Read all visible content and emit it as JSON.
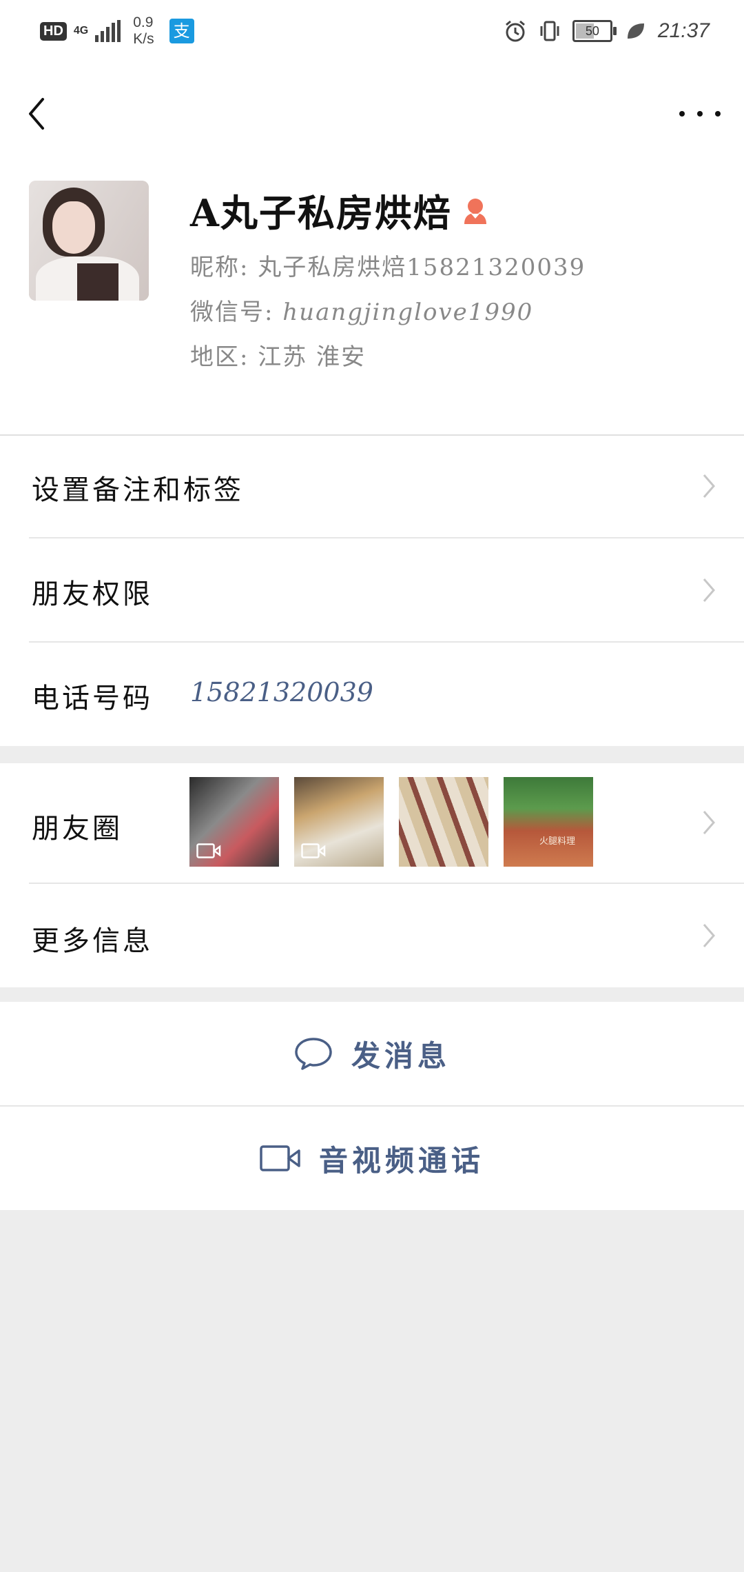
{
  "status_bar": {
    "hd": "HD",
    "network": "4G",
    "speed_value": "0.9",
    "speed_unit": "K/s",
    "alipay_glyph": "支",
    "battery_level": "50",
    "time": "21:37"
  },
  "profile": {
    "name": "A丸子私房烘焙",
    "nickname_label": "昵称:",
    "nickname": "丸子私房烘焙15821320039",
    "wechat_id_label": "微信号:",
    "wechat_id": "huangjinglove1990",
    "region_label": "地区:",
    "region": "江苏 淮安",
    "gender_icon": "female-icon",
    "gender_color": "#f0735a"
  },
  "rows": {
    "remark": "设置备注和标签",
    "permissions": "朋友权限",
    "phone_label": "电话号码",
    "phone": "15821320039",
    "moments": "朋友圈",
    "more_info": "更多信息"
  },
  "moments_thumbs": [
    {
      "kind": "video"
    },
    {
      "kind": "video"
    },
    {
      "kind": "photo"
    },
    {
      "kind": "photo",
      "caption": "火腿料理"
    }
  ],
  "actions": {
    "message": "发消息",
    "call": "音视频通话"
  },
  "colors": {
    "link_blue": "#4a5f86",
    "background": "#ededed"
  }
}
